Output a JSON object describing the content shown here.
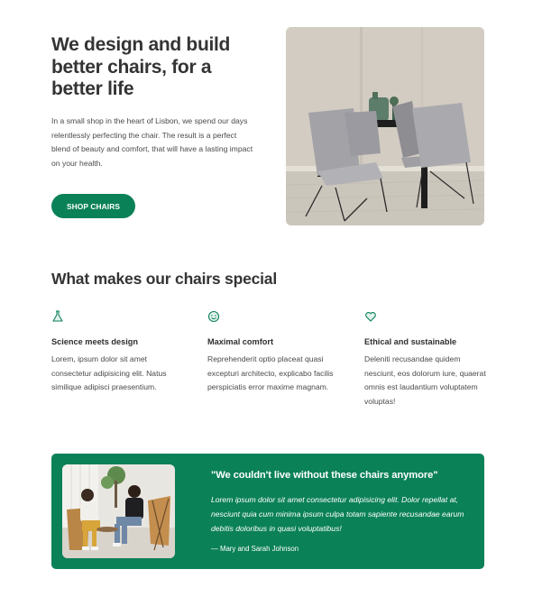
{
  "hero": {
    "title": "We design and build better chairs, for a better life",
    "text": "In a small shop in the heart of Lisbon, we spend our days relentlessly perfecting the chair. The result is a perfect blend of beauty and comfort, that will have a lasting impact on your health.",
    "button_label": "SHOP CHAIRS"
  },
  "features": {
    "title": "What makes our chairs special",
    "items": [
      {
        "icon": "flask-icon",
        "title": "Science meets design",
        "text": "Lorem, ipsum dolor sit amet consectetur adipisicing elit. Natus similique adipisci praesentium."
      },
      {
        "icon": "smile-icon",
        "title": "Maximal comfort",
        "text": "Reprehenderit optio placeat quasi excepturi architecto, explicabo facilis perspiciatis error maxime magnam."
      },
      {
        "icon": "heart-icon",
        "title": "Ethical and sustainable",
        "text": "Deleniti recusandae quidem nesciunt, eos dolorum iure, quaerat omnis est laudantium voluptatem voluptas!"
      }
    ]
  },
  "testimonial": {
    "quote": "\"We couldn't live without these chairs anymore\"",
    "text": "Lorem ipsum dolor sit amet consectetur adipisicing elit. Dolor repellat at, nesciunt quia cum minima ipsum culpa totam sapiente recusandae earum debitis doloribus in quasi voluptatibus!",
    "author": "— Mary and Sarah Johnson"
  },
  "colors": {
    "brand": "#0b8158",
    "heading": "#343434",
    "text": "#4a4a4a"
  }
}
